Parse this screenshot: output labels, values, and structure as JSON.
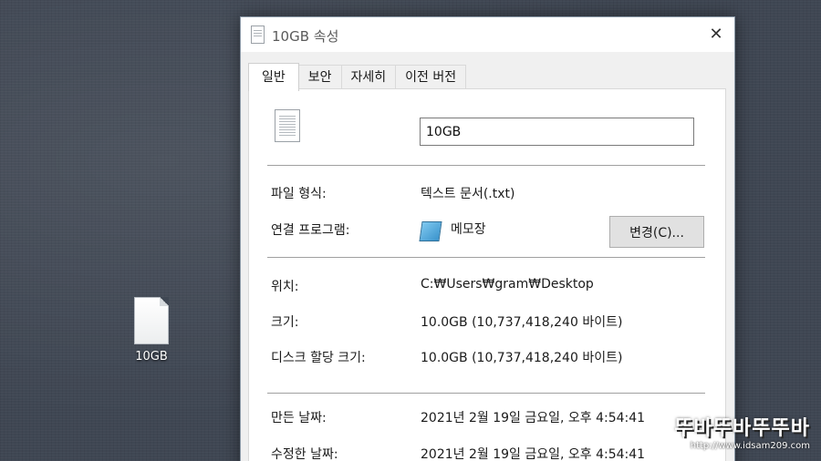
{
  "desktop": {
    "file_icon": "text-file-icon",
    "file_label": "10GB"
  },
  "dialog": {
    "title": "10GB 속성",
    "title_icon": "text-file-icon",
    "close_icon": "close-icon",
    "close_glyph": "✕",
    "tabs": [
      {
        "label": "일반",
        "active": true
      },
      {
        "label": "보안"
      },
      {
        "label": "자세히"
      },
      {
        "label": "이전 버전"
      }
    ],
    "general": {
      "file_name": "10GB",
      "file_type_label": "파일 형식:",
      "file_type_value": "텍스트 문서(.txt)",
      "opens_with_label": "연결 프로그램:",
      "opens_with_app": "메모장",
      "opens_with_icon": "notepad-icon",
      "change_button": "변경(C)...",
      "location_label": "위치:",
      "location_value": "C:₩Users₩gram₩Desktop",
      "size_label": "크기:",
      "size_value": "10.0GB (10,737,418,240 바이트)",
      "size_on_disk_label": "디스크 할당 크기:",
      "size_on_disk_value": "10.0GB (10,737,418,240 바이트)",
      "created_label": "만든 날짜:",
      "created_value": "2021년 2월 19일 금요일, 오후 4:54:41",
      "modified_label": "수정한 날짜:",
      "modified_value": "2021년 2월 19일 금요일, 오후 4:54:41"
    }
  },
  "watermark": {
    "logo": "뚜바뚜바뚜뚜바",
    "url": "http://www.idsam209.com"
  }
}
